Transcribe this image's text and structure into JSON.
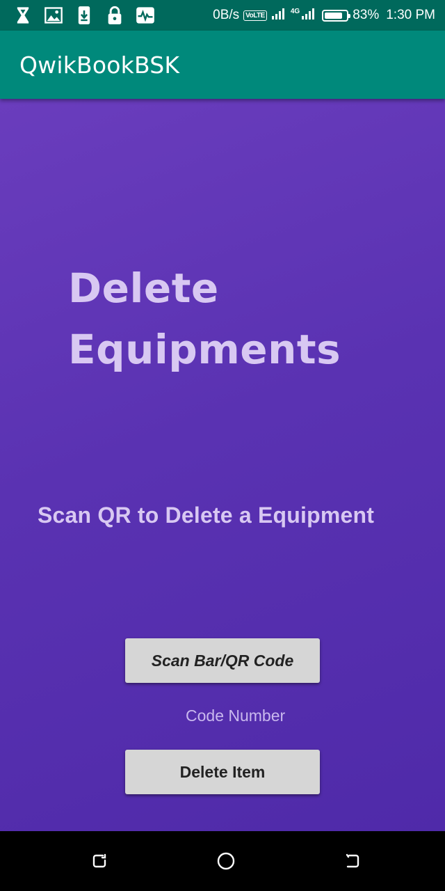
{
  "status_bar": {
    "notification_icons": [
      "hourglass-icon",
      "image-icon",
      "download-icon",
      "lock-icon",
      "activity-icon"
    ],
    "net_speed": "0B/s",
    "volte": "VoLTE",
    "network_type": "4G",
    "battery": "83%",
    "battery_level": 0.83,
    "time": "1:30 PM"
  },
  "app_bar": {
    "title": "QwikBookBSK",
    "color": "#00897b"
  },
  "main": {
    "heading_line1": "Delete",
    "heading_line2": "Equipments",
    "subheading": "Scan QR to Delete a Equipment",
    "scan_button_label": "Scan Bar/QR Code",
    "code_number_label": "Code Number",
    "delete_button_label": "Delete Item",
    "background_color": "#5a32b2",
    "text_color": "#d8c8f2"
  },
  "nav_bar": {
    "buttons": [
      "recents-icon",
      "home-icon",
      "back-icon"
    ]
  }
}
